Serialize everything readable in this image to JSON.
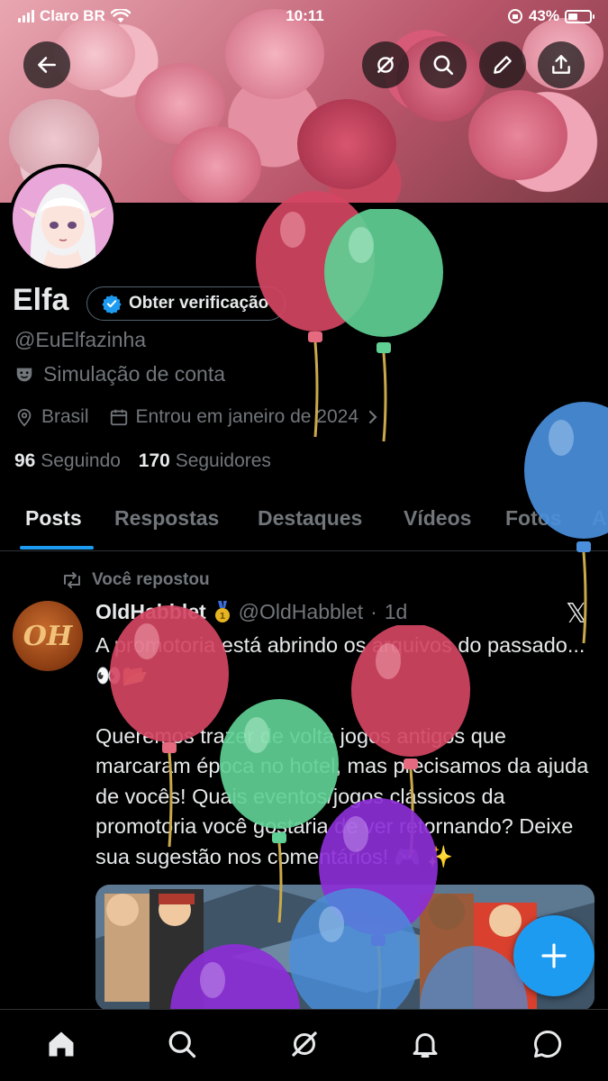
{
  "status_bar": {
    "carrier": "Claro BR",
    "time": "10:11",
    "battery": "43%"
  },
  "profile": {
    "name": "Elfa",
    "verify_label": "Obter verificação",
    "handle": "@EuElfazinha",
    "bio": "Simulação de conta",
    "location": "Brasil",
    "joined": "Entrou em janeiro de 2024",
    "following_count": "96",
    "following_label": "Seguindo",
    "followers_count": "170",
    "followers_label": "Seguidores"
  },
  "tabs": [
    {
      "label": "Posts",
      "active": true
    },
    {
      "label": "Respostas",
      "active": false
    },
    {
      "label": "Destaques",
      "active": false
    },
    {
      "label": "Vídeos",
      "active": false
    },
    {
      "label": "Fotos",
      "active": false
    },
    {
      "label": "A",
      "active": false
    }
  ],
  "post": {
    "repost_label": "Você repostou",
    "avatar_text": "OH",
    "author_name": "OldHabblet",
    "author_handle": "@OldHabblet",
    "time": "1d",
    "text": "A promotoria está abrindo os arquivos do passado... 👀📂\n\nQueremos trazer de volta jogos antigos que marcaram época no hotel, mas precisamos da ajuda de vocês! Quais eventos/jogos clássicos da promotoria você gostaria de ver retornando? Deixe sua sugestão nos comentários! 🎮 ✨"
  },
  "fab_label": "+",
  "colors": {
    "accent": "#1d9bf0",
    "background": "#000000",
    "muted": "#71767b",
    "text": "#e7e9ea"
  },
  "icons": {
    "back": "arrow-left-icon",
    "grok": "grok-icon",
    "search": "search-icon",
    "edit": "pencil-icon",
    "share": "share-icon",
    "home": "home-icon",
    "notifications": "bell-icon",
    "messages": "message-icon"
  }
}
